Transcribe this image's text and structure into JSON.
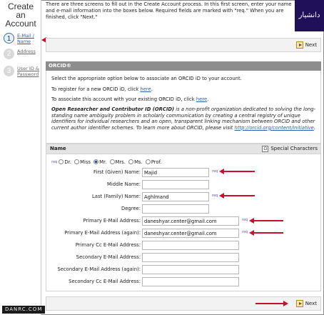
{
  "sidebar": {
    "title_line1": "Create an",
    "title_line2": "Account",
    "steps": [
      {
        "number": "1",
        "label": "E-Mail / Name"
      },
      {
        "number": "2",
        "label": "Address"
      },
      {
        "number": "3",
        "label": "User ID & Password"
      }
    ]
  },
  "intro": {
    "text": "There are three screens to fill out in the Create Account process. In this first screen, enter your name and e-mail information into the boxes below. Required fields are marked with \"req.\" When you are finished, click \"Next.\""
  },
  "watermark": {
    "text": "دانشیار"
  },
  "top_next": {
    "label": "Next"
  },
  "bottom_next": {
    "label": "Next"
  },
  "orcid": {
    "heading": "ORCID®",
    "line1": "Select the appropriate option below to associate an ORCID iD to your account.",
    "line2_prefix": "To register for a new ORCID iD, click ",
    "line2_link": "here",
    "line2_suffix": ".",
    "line3_prefix": "To associate this account with your existing ORCID iD, click ",
    "line3_link": "here",
    "line3_suffix": ".",
    "desc_bold": "Open Researcher and Contributor ID (ORCID)",
    "desc_text": " is a non-profit organization dedicated to solving the long-standing name ambiguity problem in scholarly communication by creating a central registry of unique identifiers for individual researchers and an open, transparent linking mechanism between ORCID and other current author identifier schemes. To learn more about ORCID, please visit ",
    "desc_link": "http://orcid.org/content/initiative",
    "desc_end": "."
  },
  "name_section": {
    "heading": "Name",
    "special_characters": "Special Characters",
    "special_icon": "Ω",
    "req_label": "req",
    "titles": [
      "Dr.",
      "Miss",
      "Mr.",
      "Mrs.",
      "Ms.",
      "Prof."
    ],
    "selected_title": "Mr.",
    "fields": [
      {
        "label": "First (Given) Name:",
        "value": "Majid",
        "required": true
      },
      {
        "label": "Middle Name:",
        "value": "",
        "required": false
      },
      {
        "label": "Last (Family) Name:",
        "value": "Aghlmand",
        "required": true
      },
      {
        "label": "Degree:",
        "value": "",
        "required": false
      },
      {
        "label": "Primary E-Mail Address:",
        "value": "daneshyar.center@gmail.com",
        "required": true
      },
      {
        "label": "Primary E-Mail Address (again):",
        "value": "daneshyar.center@gmail.com",
        "required": true
      },
      {
        "label": "Primary Cc E-Mail Address:",
        "value": "",
        "required": false
      },
      {
        "label": "Secondary E-Mail Address:",
        "value": "",
        "required": false
      },
      {
        "label": "Secondary E-Mail Address (again):",
        "value": "",
        "required": false
      },
      {
        "label": "Secondary Cc E-Mail Address:",
        "value": "",
        "required": false
      }
    ]
  },
  "footer": {
    "brand": "DANRC.COM"
  },
  "colors": {
    "accent_arrow": "#c8102e",
    "section_header": "#8d8d8d",
    "link": "#2b5ea8"
  }
}
